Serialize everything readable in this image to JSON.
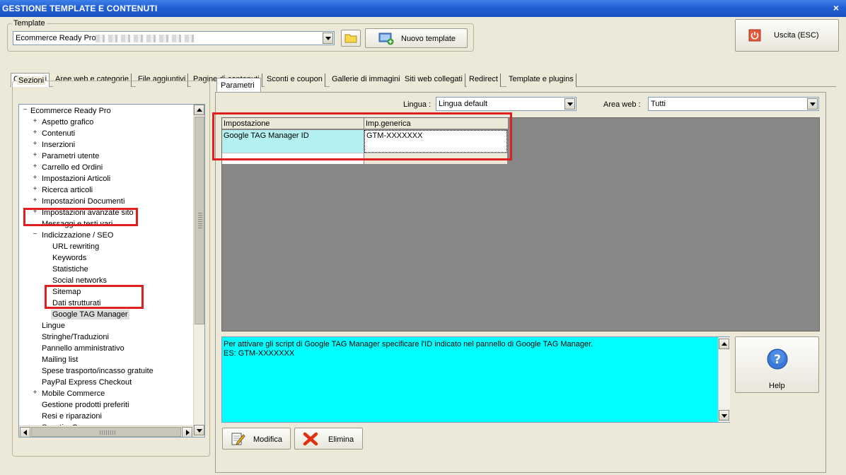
{
  "window": {
    "title": "GESTIONE TEMPLATE E CONTENUTI",
    "close_glyph": "×"
  },
  "template_group": {
    "legend": "Template",
    "selected": "Ecommerce Ready Pro",
    "new_button": "Nuovo template"
  },
  "exit_button": "Uscita (ESC)",
  "tabs": [
    "Contenuti",
    "Aree web e categorie",
    "File aggiuntivi",
    "Pagine di contenuti",
    "Sconti e coupon",
    "Gallerie di immagini",
    "Siti web collegati",
    "Redirect",
    "Template e plugins"
  ],
  "sections": {
    "legend": "Sezioni",
    "tree": [
      {
        "label": "Ecommerce Ready Pro",
        "level": 0,
        "expander": "−"
      },
      {
        "label": "Aspetto grafico",
        "level": 1,
        "expander": "+"
      },
      {
        "label": "Contenuti",
        "level": 1,
        "expander": "+"
      },
      {
        "label": "Inserzioni",
        "level": 1,
        "expander": "+"
      },
      {
        "label": "Parametri utente",
        "level": 1,
        "expander": "+"
      },
      {
        "label": "Carrello ed Ordini",
        "level": 1,
        "expander": "+"
      },
      {
        "label": "Impostazioni Articoli",
        "level": 1,
        "expander": "+"
      },
      {
        "label": "Ricerca articoli",
        "level": 1,
        "expander": "+"
      },
      {
        "label": "Impostazioni Documenti",
        "level": 1,
        "expander": "+"
      },
      {
        "label": "Impostazioni avanzate sito",
        "level": 1,
        "expander": "+"
      },
      {
        "label": "Messaggi e testi vari",
        "level": 1,
        "expander": ""
      },
      {
        "label": "Indicizzazione / SEO",
        "level": 1,
        "expander": "−"
      },
      {
        "label": "URL rewriting",
        "level": 2,
        "expander": ""
      },
      {
        "label": "Keywords",
        "level": 2,
        "expander": ""
      },
      {
        "label": "Statistiche",
        "level": 2,
        "expander": ""
      },
      {
        "label": "Social networks",
        "level": 2,
        "expander": ""
      },
      {
        "label": "Sitemap",
        "level": 2,
        "expander": ""
      },
      {
        "label": "Dati strutturati",
        "level": 2,
        "expander": ""
      },
      {
        "label": "Google TAG Manager",
        "level": 2,
        "expander": "",
        "selected": true
      },
      {
        "label": "Lingue",
        "level": 1,
        "expander": ""
      },
      {
        "label": "Stringhe/Traduzioni",
        "level": 1,
        "expander": ""
      },
      {
        "label": "Pannello amministrativo",
        "level": 1,
        "expander": ""
      },
      {
        "label": "Mailing list",
        "level": 1,
        "expander": ""
      },
      {
        "label": "Spese trasporto/incasso gratuite",
        "level": 1,
        "expander": ""
      },
      {
        "label": "PayPal Express Checkout",
        "level": 1,
        "expander": ""
      },
      {
        "label": "Mobile Commerce",
        "level": 1,
        "expander": "+"
      },
      {
        "label": "Gestione prodotti preferiti",
        "level": 1,
        "expander": ""
      },
      {
        "label": "Resi e riparazioni",
        "level": 1,
        "expander": ""
      },
      {
        "label": "Sconti e Coupon",
        "level": 1,
        "expander": ""
      }
    ]
  },
  "params": {
    "tab": "Parametri",
    "lingua_label": "Lingua :",
    "lingua_value": "Lingua default",
    "area_label": "Area web :",
    "area_value": "Tutti",
    "grid": {
      "headers": [
        "Impostazione",
        "Imp.generica"
      ],
      "rows": [
        [
          "Google TAG Manager ID",
          "GTM-XXXXXXX"
        ]
      ]
    },
    "description": [
      "Per attivare gli script di Google TAG Manager specificare l'ID indicato nel pannello di Google TAG Manager.",
      "ES: GTM-XXXXXXX"
    ],
    "help": "Help",
    "modify": "Modifica",
    "delete": "Elimina"
  },
  "colors": {
    "titlebar": "#2160d4",
    "highlight": "#e02020",
    "description_bg": "#00ffff",
    "grid_area": "#878787",
    "row_highlight": "#b4f0f0"
  }
}
